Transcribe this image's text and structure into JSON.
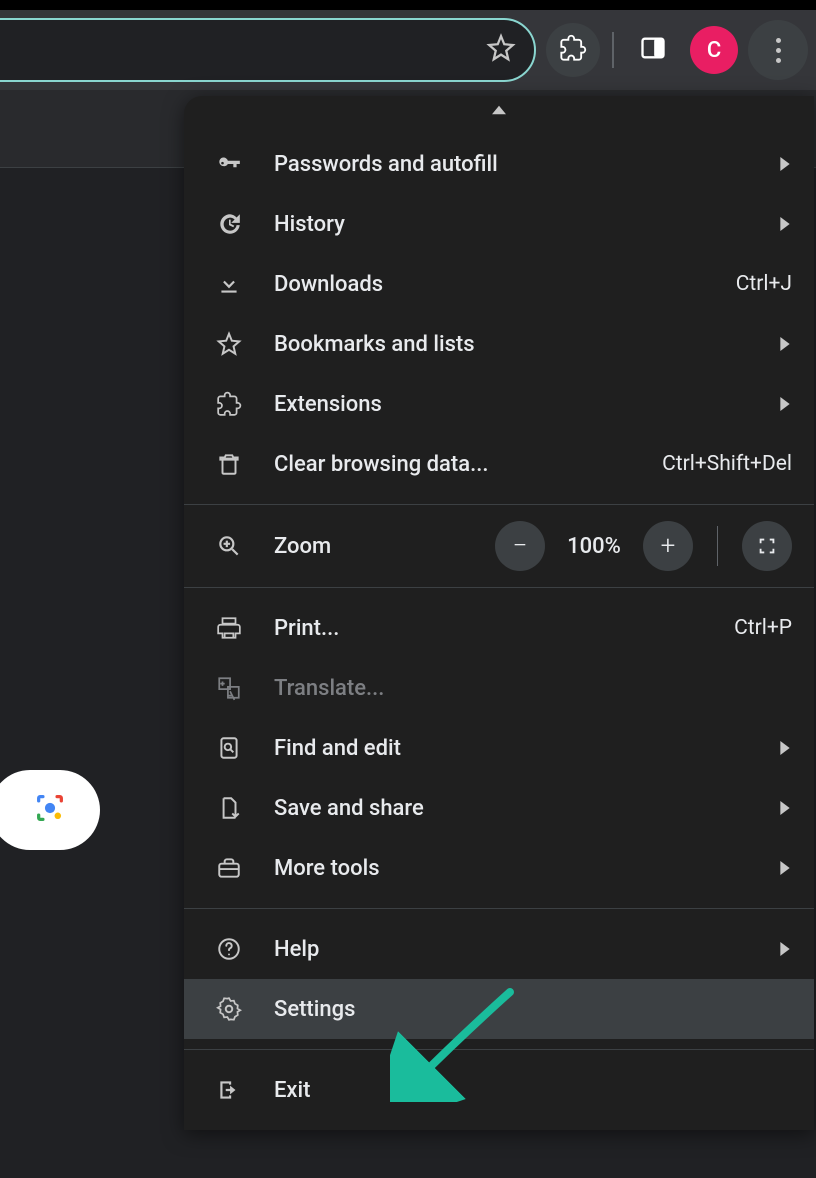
{
  "toolbar": {
    "avatar_letter": "C"
  },
  "menu": {
    "passwords": "Passwords and autofill",
    "history": "History",
    "downloads": "Downloads",
    "downloads_accel": "Ctrl+J",
    "bookmarks": "Bookmarks and lists",
    "extensions": "Extensions",
    "clear": "Clear browsing data...",
    "clear_accel": "Ctrl+Shift+Del",
    "zoom_label": "Zoom",
    "zoom_value": "100%",
    "print": "Print...",
    "print_accel": "Ctrl+P",
    "translate": "Translate...",
    "find": "Find and edit",
    "save": "Save and share",
    "more_tools": "More tools",
    "help": "Help",
    "settings": "Settings",
    "exit": "Exit"
  }
}
